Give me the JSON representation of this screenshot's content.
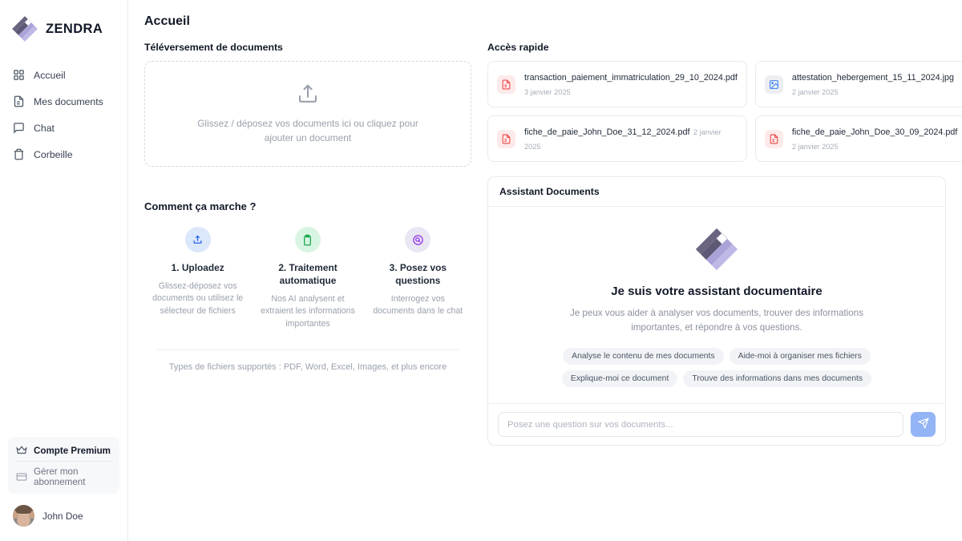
{
  "brand": {
    "name": "ZENDRA",
    "logo_icon": "zendra-diamond-logo"
  },
  "sidebar": {
    "items": [
      {
        "label": "Accueil",
        "icon": "grid-icon"
      },
      {
        "label": "Mes documents",
        "icon": "file-text-icon"
      },
      {
        "label": "Chat",
        "icon": "message-square-icon"
      },
      {
        "label": "Corbeille",
        "icon": "trash-icon"
      }
    ],
    "premium": {
      "title": "Compte Premium",
      "title_icon": "crown-icon",
      "manage": "Gérer mon abonnement",
      "manage_icon": "credit-card-icon"
    },
    "user": {
      "name": "John Doe",
      "avatar_icon": "user-avatar"
    }
  },
  "main": {
    "page_title": "Accueil",
    "upload": {
      "section_label": "Téléversement de documents",
      "icon": "upload-icon",
      "hint": "Glissez / déposez vos documents ici ou cliquez pour ajouter un document"
    },
    "how_it_works": {
      "title": "Comment ça marche ?",
      "steps": [
        {
          "heading": "1. Uploadez",
          "text": "Glissez-déposez vos documents ou utilisez le sélecteur de fichiers",
          "icon": "upload-icon",
          "color": "#2563eb",
          "bg": "#dbe7fb"
        },
        {
          "heading": "2. Traitement automatique",
          "text": "Nos AI analysent et extraient les informations importantes",
          "icon": "clipboard-icon",
          "color": "#16a34a",
          "bg": "#d8f5e3"
        },
        {
          "heading": "3. Posez vos questions",
          "text": "Interrogez vos documents dans le chat",
          "icon": "search-circle-icon",
          "color": "#9333ea",
          "bg": "#e9e7f3"
        }
      ],
      "footer": "Types de fichiers supportés : PDF, Word, Excel, Images, et plus encore"
    }
  },
  "quick_access": {
    "section_label": "Accès rapide",
    "files": [
      {
        "name": "transaction_paiement_immatriculation_29_10_2024.pdf",
        "date": "3 janvier 2025",
        "type": "pdf",
        "icon": "pdf-file-icon"
      },
      {
        "name": "attestation_hebergement_15_11_2024.jpg",
        "date": "2 janvier 2025",
        "type": "image",
        "icon": "image-file-icon"
      },
      {
        "name": "fiche_de_paie_John_Doe_31_12_2024.pdf",
        "date": "2 janvier 2025",
        "type": "pdf",
        "icon": "pdf-file-icon"
      },
      {
        "name": "fiche_de_paie_John_Doe_30_09_2024.pdf",
        "date": "2 janvier 2025",
        "type": "pdf",
        "icon": "pdf-file-icon"
      }
    ]
  },
  "assistant": {
    "header": "Assistant Documents",
    "logo_icon": "zendra-diamond-logo",
    "heading": "Je suis votre assistant documentaire",
    "description": "Je peux vous aider à analyser vos documents, trouver des informations importantes, et répondre à vos questions.",
    "suggestions": [
      "Analyse le contenu de mes documents",
      "Aide-moi à organiser mes fichiers",
      "Explique-moi ce document",
      "Trouve des informations dans mes documents"
    ],
    "input_placeholder": "Posez une question sur vos documents...",
    "input_value": "",
    "send_icon": "send-icon",
    "send_button_color": "#93b4f5"
  },
  "colors": {
    "accent": "#93b4f5",
    "pdf": "#ef4444",
    "image": "#3b82f6",
    "text": "#111827",
    "muted": "#9aa1ad",
    "border": "#e9eaee"
  }
}
